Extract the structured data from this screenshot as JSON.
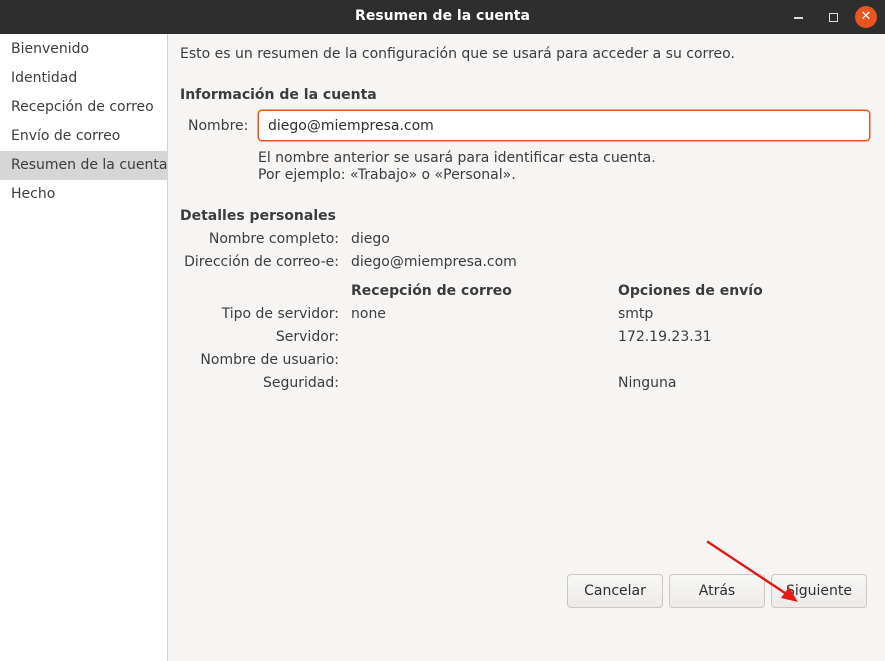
{
  "window": {
    "title": "Resumen de la cuenta"
  },
  "sidebar": {
    "items": [
      {
        "label": "Bienvenido"
      },
      {
        "label": "Identidad"
      },
      {
        "label": "Recepción de correo"
      },
      {
        "label": "Envío de correo"
      },
      {
        "label": "Resumen de la cuenta",
        "active": true
      },
      {
        "label": "Hecho"
      }
    ]
  },
  "main": {
    "intro": "Esto es un resumen de la configuración que se usará para acceder a su correo.",
    "account_info": {
      "heading": "Información de la cuenta",
      "name_label": "Nombre:",
      "name_value": "diego@miempresa.com",
      "hint_line1": "El nombre anterior se usará para identificar esta cuenta.",
      "hint_line2": "Por ejemplo: «Trabajo» o «Personal»."
    },
    "personal": {
      "heading": "Detalles personales",
      "fullname_label": "Nombre completo:",
      "fullname_value": "diego",
      "email_label": "Dirección de correo-e:",
      "email_value": "diego@miempresa.com"
    },
    "servers": {
      "receive_header": "Recepción de correo",
      "send_header": "Opciones de envío",
      "type_label": "Tipo de servidor:",
      "type_receive": "none",
      "type_send": "smtp",
      "server_label": "Servidor:",
      "server_receive": "",
      "server_send": "172.19.23.31",
      "username_label": "Nombre de usuario:",
      "username_receive": "",
      "username_send": "",
      "security_label": "Seguridad:",
      "security_receive": "",
      "security_send": "Ninguna"
    }
  },
  "buttons": {
    "cancel": "Cancelar",
    "back": "Atrás",
    "next": "Siguiente"
  },
  "colors": {
    "titlebar": "#2e2e2e",
    "accent": "#e95420",
    "annotation_arrow": "#e41b1b"
  },
  "icons": {
    "minimize": "minimize-icon",
    "maximize": "maximize-icon",
    "close": "close-icon",
    "annotation": "red-arrow-annotation"
  }
}
